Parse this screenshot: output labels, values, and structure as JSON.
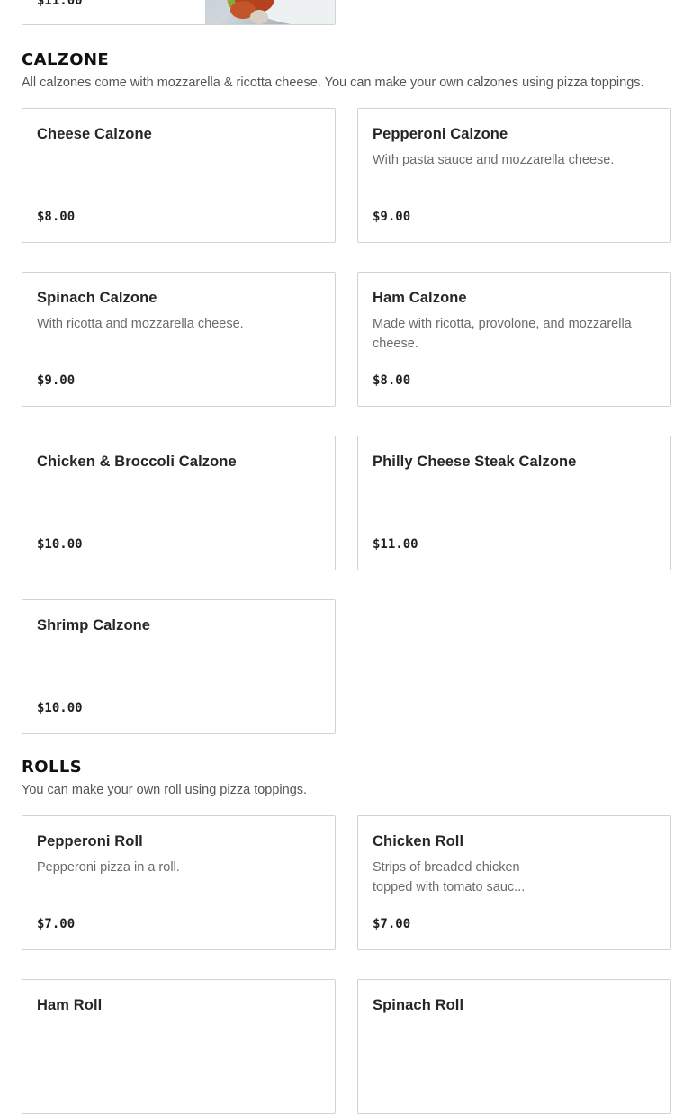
{
  "prev_item": {
    "price": "$11.00"
  },
  "calzone": {
    "title": "CALZONE",
    "description": "All calzones come with mozzarella & ricotta cheese. You can make your own calzones using pizza toppings.",
    "items": [
      {
        "name": "Cheese Calzone",
        "description": "",
        "price": "$8.00"
      },
      {
        "name": "Pepperoni Calzone",
        "description": "With pasta sauce and mozzarella cheese.",
        "price": "$9.00"
      },
      {
        "name": "Spinach Calzone",
        "description": "With ricotta and mozzarella cheese.",
        "price": "$9.00"
      },
      {
        "name": "Ham Calzone",
        "description": "Made with ricotta, provolone, and mozzarella cheese.",
        "price": "$8.00"
      },
      {
        "name": "Chicken & Broccoli Calzone",
        "description": "",
        "price": "$10.00"
      },
      {
        "name": "Philly Cheese Steak Calzone",
        "description": "",
        "price": "$11.00"
      },
      {
        "name": "Shrimp Calzone",
        "description": "",
        "price": "$10.00"
      }
    ]
  },
  "rolls": {
    "title": "ROLLS",
    "description": "You can make your own roll using pizza toppings.",
    "items": [
      {
        "name": "Pepperoni Roll",
        "description": "Pepperoni pizza in a roll.",
        "price": "$7.00"
      },
      {
        "name": "Chicken Roll",
        "description": "Strips of breaded chicken topped with tomato sauc...",
        "price": "$7.00"
      },
      {
        "name": "Ham Roll",
        "description": "",
        "price": ""
      },
      {
        "name": "Spinach Roll",
        "description": "",
        "price": ""
      }
    ]
  }
}
